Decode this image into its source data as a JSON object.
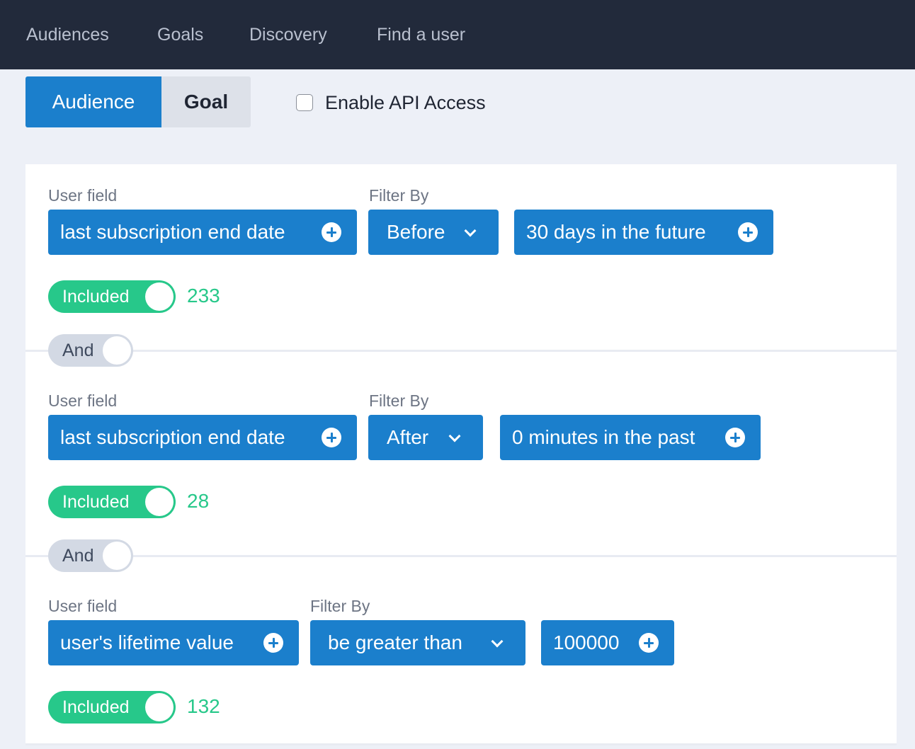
{
  "nav": {
    "items": [
      "Audiences",
      "Goals",
      "Discovery",
      "Find a user"
    ]
  },
  "tabs": {
    "audience": "Audience",
    "goal": "Goal"
  },
  "api_access": {
    "label": "Enable API Access",
    "checked": false
  },
  "filters": [
    {
      "user_field_label": "User field",
      "filter_by_label": "Filter By",
      "field": "last subscription end date",
      "operator": "Before",
      "value": "30 days in the future",
      "state": "Included",
      "count": "233"
    },
    {
      "user_field_label": "User field",
      "filter_by_label": "Filter By",
      "field": "last subscription end date",
      "operator": "After",
      "value": "0 minutes in the past",
      "state": "Included",
      "count": "28"
    },
    {
      "user_field_label": "User field",
      "filter_by_label": "Filter By",
      "field": "user's lifetime value",
      "operator": "be greater than",
      "value": "100000",
      "state": "Included",
      "count": "132"
    }
  ],
  "connectors": [
    "And",
    "And"
  ],
  "colors": {
    "nav_bg": "#222a3b",
    "primary": "#1b7fcc",
    "included_green": "#27c88a",
    "page_bg": "#edf0f7"
  }
}
